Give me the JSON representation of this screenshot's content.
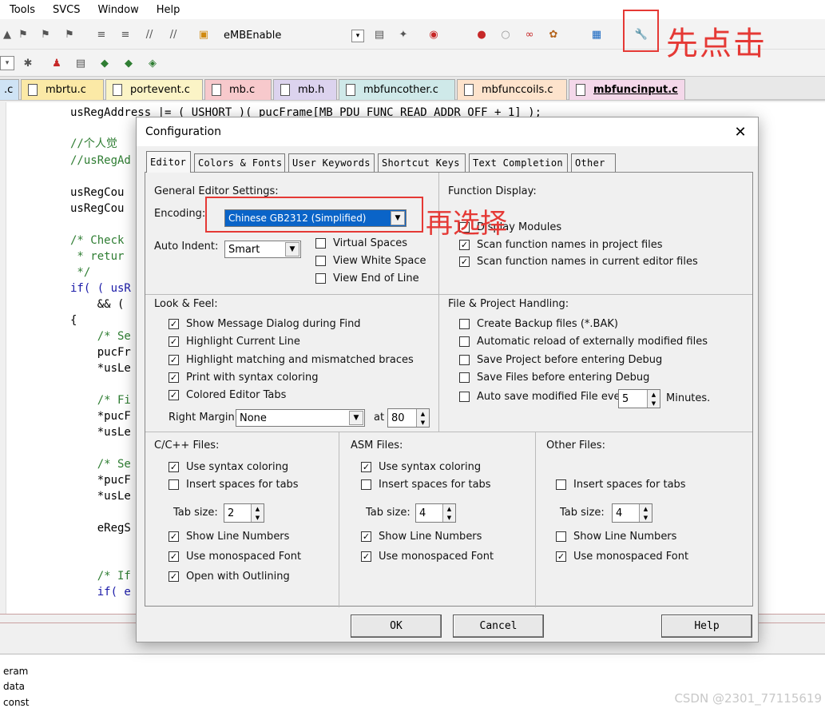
{
  "menu": {
    "items": [
      "Tools",
      "SVCS",
      "Window",
      "Help"
    ]
  },
  "toolbar": {
    "function_box": "eMBEnable"
  },
  "tabs": [
    ".c",
    "mbrtu.c",
    "portevent.c",
    "mb.c",
    "mb.h",
    "mbfuncother.c",
    "mbfunccoils.c",
    "mbfuncinput.c"
  ],
  "editor": {
    "lines": [
      "usRegAddress |= ( USHORT )( pucFrame[MB_PDU_FUNC_READ_ADDR_OFF + 1] );",
      "//个人觉",
      "//usRegAd",
      "usRegCou",
      "usRegCou",
      "/* Check",
      " * retur",
      " */",
      "if( ( usR",
      "    && (",
      "{",
      "    /* Se",
      "    pucFr",
      "    *usLe",
      "    /* Fi",
      "    *pucF",
      "    *usLe",
      "    /* Se",
      "    *pucF",
      "    *usLe",
      "    eRegS",
      "    /* If",
      "    if( e"
    ]
  },
  "bottom": {
    "items": [
      "eram",
      "data",
      "const"
    ]
  },
  "watermark": "CSDN @2301_77115619",
  "annotations": {
    "click_first": "先点击",
    "then_select": "再选择"
  },
  "dialog": {
    "title": "Configuration",
    "tabs": [
      "Editor",
      "Colors & Fonts",
      "User Keywords",
      "Shortcut Keys",
      "Text Completion",
      "Other"
    ],
    "general": {
      "header": "General Editor Settings:",
      "encoding_label": "Encoding:",
      "encoding_value": "Chinese GB2312 (Simplified)",
      "auto_indent_label": "Auto Indent:",
      "auto_indent_value": "Smart",
      "virtual_spaces": "Virtual Spaces",
      "view_white_space": "View White Space",
      "view_end_of_line": "View End of Line"
    },
    "function_display": {
      "header": "Function Display:",
      "display_modules": "Display Modules",
      "scan_project": "Scan function names in project files",
      "scan_editor": "Scan function names in current editor files"
    },
    "look_feel": {
      "header": "Look & Feel:",
      "items": [
        "Show Message Dialog during Find",
        "Highlight Current Line",
        "Highlight matching and mismatched braces",
        "Print with syntax coloring",
        "Colored Editor Tabs"
      ],
      "right_margin_label": "Right Margin:",
      "right_margin_value": "None",
      "at_label": "at",
      "at_value": "80"
    },
    "file_project": {
      "header": "File & Project Handling:",
      "items": [
        "Create Backup files (*.BAK)",
        "Automatic reload of externally modified files",
        "Save Project before entering Debug",
        "Save Files before entering Debug",
        "Auto save modified File every"
      ],
      "auto_save_value": "5",
      "minutes_label": "Minutes."
    },
    "c_files": {
      "header": "C/C++ Files:",
      "syntax": "Use syntax coloring",
      "insert_spaces": "Insert spaces for tabs",
      "tab_size_label": "Tab size:",
      "tab_size": "2",
      "line_numbers": "Show Line Numbers",
      "monospaced": "Use monospaced Font",
      "outlining": "Open with Outlining"
    },
    "asm_files": {
      "header": "ASM Files:",
      "syntax": "Use syntax coloring",
      "insert_spaces": "Insert spaces for tabs",
      "tab_size_label": "Tab size:",
      "tab_size": "4",
      "line_numbers": "Show Line Numbers",
      "monospaced": "Use monospaced Font"
    },
    "other_files": {
      "header": "Other Files:",
      "insert_spaces": "Insert spaces for tabs",
      "tab_size_label": "Tab size:",
      "tab_size": "4",
      "line_numbers": "Show Line Numbers",
      "monospaced": "Use monospaced Font"
    },
    "buttons": {
      "ok": "OK",
      "cancel": "Cancel",
      "help": "Help"
    }
  },
  "colors": {
    "annotation": "#e53935",
    "selection": "#0a64c8"
  }
}
